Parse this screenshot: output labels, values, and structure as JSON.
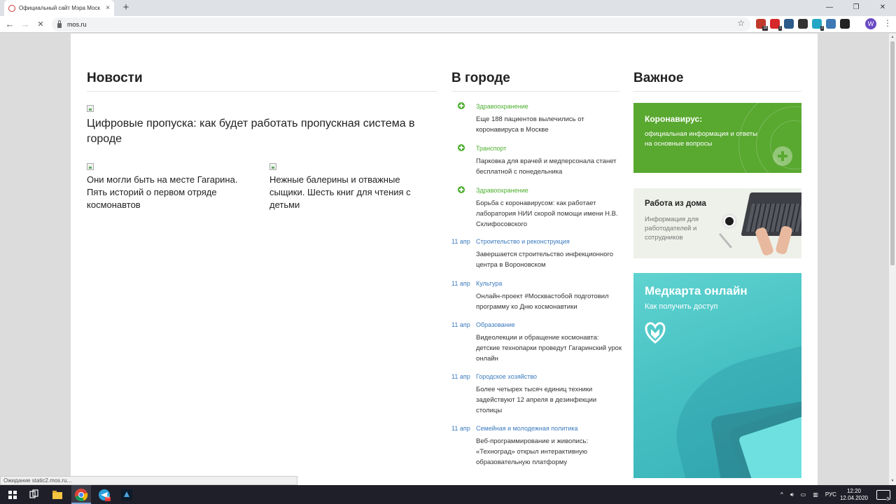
{
  "browser": {
    "tab_title": "Официальный сайт Мэра Моск",
    "tab_close": "×",
    "new_tab": "+",
    "url": "mos.ru",
    "status": "Ожидание static2.mos.ru...",
    "nav_back": "←",
    "nav_forward": "→",
    "nav_reload": "✕",
    "bookmark": "☆",
    "menu": "⋮",
    "profile_initial": "W",
    "win_minimize": "—",
    "win_maximize": "❐",
    "win_close": "✕",
    "extensions": [
      {
        "icon": "adblock-icon",
        "color": "#c0392b",
        "badge": "18"
      },
      {
        "icon": "shield-icon",
        "color": "#d62828",
        "badge": "1"
      },
      {
        "icon": "monitor-icon",
        "color": "#2c5b8a",
        "badge": ""
      },
      {
        "icon": "s-extension-icon",
        "color": "#333333",
        "badge": ""
      },
      {
        "icon": "translate-icon",
        "color": "#23a7c5",
        "badge": "2"
      },
      {
        "icon": "photo-icon",
        "color": "#3d78b5",
        "badge": ""
      },
      {
        "icon": "puzzle-icon",
        "color": "#222222",
        "badge": ""
      }
    ]
  },
  "sections": {
    "news": "Новости",
    "city": "В городе",
    "important": "Важное"
  },
  "news": {
    "main": "Цифровые пропуска: как будет работать пропускная система в городе",
    "small": [
      "Они могли быть на месте Гагарина. Пять историй о первом отряде космонавтов",
      "Нежные балерины и отважные сыщики. Шесть книг для чтения с детьми"
    ]
  },
  "city": [
    {
      "date": "",
      "category": "Здравоохранение",
      "text": "Еще 188 пациентов вылечились от коронавируса в Москве"
    },
    {
      "date": "",
      "category": "Транспорт",
      "text": "Парковка для врачей и медперсонала станет бесплатной с понедельника"
    },
    {
      "date": "",
      "category": "Здравоохранение",
      "text": "Борьба с коронавирусом: как работает лаборатория НИИ скорой помощи имени Н.В. Склифосовского"
    },
    {
      "date": "11 апр",
      "category": "Строительство и реконструкция",
      "text": "Завершается строительство инфекционного центра в Вороновском"
    },
    {
      "date": "11 апр",
      "category": "Культура",
      "text": "Онлайн-проект #Москвастобой подготовил программу ко Дню космонавтики"
    },
    {
      "date": "11 апр",
      "category": "Образование",
      "text": "Видеолекции и обращение космонавта: детские технопарки проведут Гагаринский урок онлайн"
    },
    {
      "date": "11 апр",
      "category": "Городское хозяйство",
      "text": "Более четырех тысяч единиц техники задействуют 12 апреля в дезинфекции столицы"
    },
    {
      "date": "11 апр",
      "category": "Семейная и молодежная политика",
      "text": "Веб-программирование и живопись: «Техноград» открыл интерактивную образовательную платформу"
    }
  ],
  "banners": {
    "covid": {
      "title": "Коронавирус:",
      "subtitle": "официальная информация и ответы на основные вопросы"
    },
    "work": {
      "title": "Работа из дома",
      "subtitle": "Информация для работодателей и сотрудников"
    },
    "med": {
      "title": "Медкарта онлайн",
      "subtitle": "Как получить доступ"
    }
  },
  "taskbar": {
    "lang": "РУС",
    "time": "12:20",
    "date": "12.04.2020",
    "tray_chevron": "^",
    "notifications": "3",
    "telegram_badge": "99"
  },
  "colors": {
    "green": "#4caf2f",
    "blue": "#3a7abd",
    "covid_banner": "#59a830",
    "med_banner": "#49c2c4"
  }
}
